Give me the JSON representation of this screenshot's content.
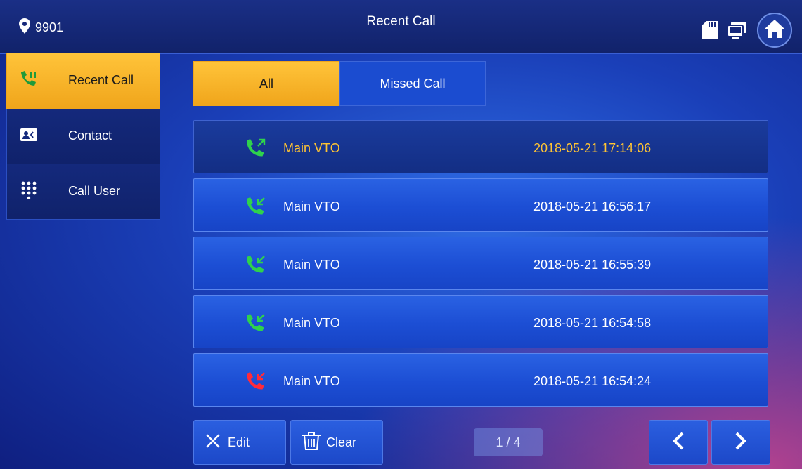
{
  "header": {
    "location": "9901",
    "title": "Recent Call"
  },
  "sidebar": {
    "items": [
      {
        "label": "Recent Call",
        "icon": "phone-icon",
        "active": true
      },
      {
        "label": "Contact",
        "icon": "contact-card-icon",
        "active": false
      },
      {
        "label": "Call User",
        "icon": "dialpad-icon",
        "active": false
      }
    ]
  },
  "tabs": [
    {
      "label": "All",
      "active": true
    },
    {
      "label": "Missed Call",
      "active": false
    }
  ],
  "calls": [
    {
      "type": "outgoing",
      "name": "Main VTO",
      "time": "2018-05-21 17:14:06",
      "selected": true
    },
    {
      "type": "incoming",
      "name": "Main VTO",
      "time": "2018-05-21 16:56:17",
      "selected": false
    },
    {
      "type": "incoming",
      "name": "Main VTO",
      "time": "2018-05-21 16:55:39",
      "selected": false
    },
    {
      "type": "incoming",
      "name": "Main VTO",
      "time": "2018-05-21 16:54:58",
      "selected": false
    },
    {
      "type": "missed",
      "name": "Main VTO",
      "time": "2018-05-21 16:54:24",
      "selected": false
    }
  ],
  "footer": {
    "edit_label": "Edit",
    "clear_label": "Clear",
    "page_indicator": "1 / 4"
  },
  "colors": {
    "accent": "#f5b025",
    "selected_text": "#ffc433",
    "call_green": "#2fd14d",
    "call_red": "#ff2a3a"
  }
}
